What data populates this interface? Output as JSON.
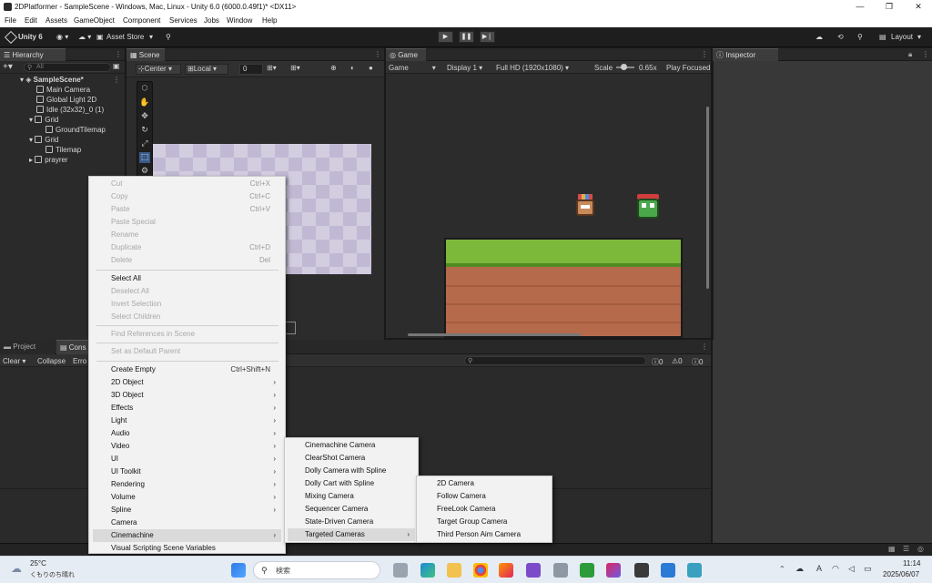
{
  "window": {
    "title": "2DPlatformer - SampleScene - Windows, Mac, Linux - Unity 6.0 (6000.0.49f1)* <DX11>",
    "controls": [
      "—",
      "❐",
      "✕"
    ]
  },
  "menubar": [
    "File",
    "Edit",
    "Assets",
    "GameObject",
    "Component",
    "Services",
    "Jobs",
    "Window",
    "Help"
  ],
  "toolbar": {
    "unity_label": "Unity 6",
    "asset_store": "Asset Store",
    "layout": "Layout"
  },
  "hierarchy": {
    "tab": "Hierarchy",
    "search_placeholder": "All",
    "items": [
      {
        "label": "SampleScene*"
      },
      {
        "label": "Main Camera"
      },
      {
        "label": "Global Light 2D"
      },
      {
        "label": "Idle (32x32)_0 (1)"
      },
      {
        "label": "Grid"
      },
      {
        "label": "GroundTilemap"
      },
      {
        "label": "Grid"
      },
      {
        "label": "Tilemap"
      },
      {
        "label": "prayrer"
      }
    ]
  },
  "scene": {
    "tab": "Scene",
    "pivot": "Center",
    "space": "Local",
    "snap_value": "0"
  },
  "game": {
    "tab": "Game",
    "mode": "Game",
    "display": "Display 1",
    "resolution": "Full HD (1920x1080)",
    "scale_label": "Scale",
    "scale_value": "0.65x",
    "play_focused": "Play Focused"
  },
  "inspector": {
    "tab": "Inspector"
  },
  "bottom": {
    "tab_project": "Project",
    "tab_console": "Cons",
    "clear": "Clear",
    "collapse": "Collapse",
    "error_pause": "Erro",
    "counts": [
      "0",
      "0",
      "0"
    ]
  },
  "context_menu": {
    "items": [
      {
        "label": "Cut",
        "shortcut": "Ctrl+X",
        "disabled": true
      },
      {
        "label": "Copy",
        "shortcut": "Ctrl+C",
        "disabled": true
      },
      {
        "label": "Paste",
        "shortcut": "Ctrl+V",
        "disabled": true
      },
      {
        "label": "Paste Special",
        "disabled": true
      },
      {
        "label": "Rename",
        "disabled": true
      },
      {
        "label": "Duplicate",
        "shortcut": "Ctrl+D",
        "disabled": true
      },
      {
        "label": "Delete",
        "shortcut": "Del",
        "disabled": true
      },
      {
        "label": "Select All"
      },
      {
        "label": "Deselect All",
        "disabled": true
      },
      {
        "label": "Invert Selection",
        "disabled": true
      },
      {
        "label": "Select Children",
        "disabled": true
      },
      {
        "label": "Find References in Scene",
        "disabled": true
      },
      {
        "label": "Set as Default Parent",
        "disabled": true
      },
      {
        "label": "Create Empty",
        "shortcut": "Ctrl+Shift+N"
      },
      {
        "label": "2D Object",
        "submenu": true
      },
      {
        "label": "3D Object",
        "submenu": true
      },
      {
        "label": "Effects",
        "submenu": true
      },
      {
        "label": "Light",
        "submenu": true
      },
      {
        "label": "Audio",
        "submenu": true
      },
      {
        "label": "Video",
        "submenu": true
      },
      {
        "label": "UI",
        "submenu": true
      },
      {
        "label": "UI Toolkit",
        "submenu": true
      },
      {
        "label": "Rendering",
        "submenu": true
      },
      {
        "label": "Volume",
        "submenu": true
      },
      {
        "label": "Spline",
        "submenu": true
      },
      {
        "label": "Camera"
      },
      {
        "label": "Cinemachine",
        "submenu": true,
        "highlighted": true
      },
      {
        "label": "Visual Scripting Scene Variables"
      }
    ]
  },
  "cinemachine_submenu": {
    "items": [
      {
        "label": "Cinemachine Camera"
      },
      {
        "label": "ClearShot Camera"
      },
      {
        "label": "Dolly Camera with Spline"
      },
      {
        "label": "Dolly Cart with Spline"
      },
      {
        "label": "Mixing Camera"
      },
      {
        "label": "Sequencer Camera"
      },
      {
        "label": "State-Driven Camera"
      },
      {
        "label": "Targeted Cameras",
        "submenu": true,
        "highlighted": true
      }
    ]
  },
  "targeted_submenu": {
    "items": [
      {
        "label": "2D Camera"
      },
      {
        "label": "Follow Camera"
      },
      {
        "label": "FreeLook Camera"
      },
      {
        "label": "Target Group Camera"
      },
      {
        "label": "Third Person Aim Camera"
      }
    ]
  },
  "taskbar": {
    "weather_temp": "25°C",
    "weather_desc": "くもりのち晴れ",
    "search_placeholder": "検索",
    "ime": "A",
    "time": "11:14",
    "date": "2025/06/07"
  },
  "colors": {
    "editor_bg": "#191919",
    "panel_bg": "#2a2a2a",
    "inspector_bg": "#383838",
    "menu_bg": "#f2f2f2",
    "menu_highlight": "#dadada",
    "grass": "#7cb83a",
    "dirt": "#b56b4b"
  }
}
